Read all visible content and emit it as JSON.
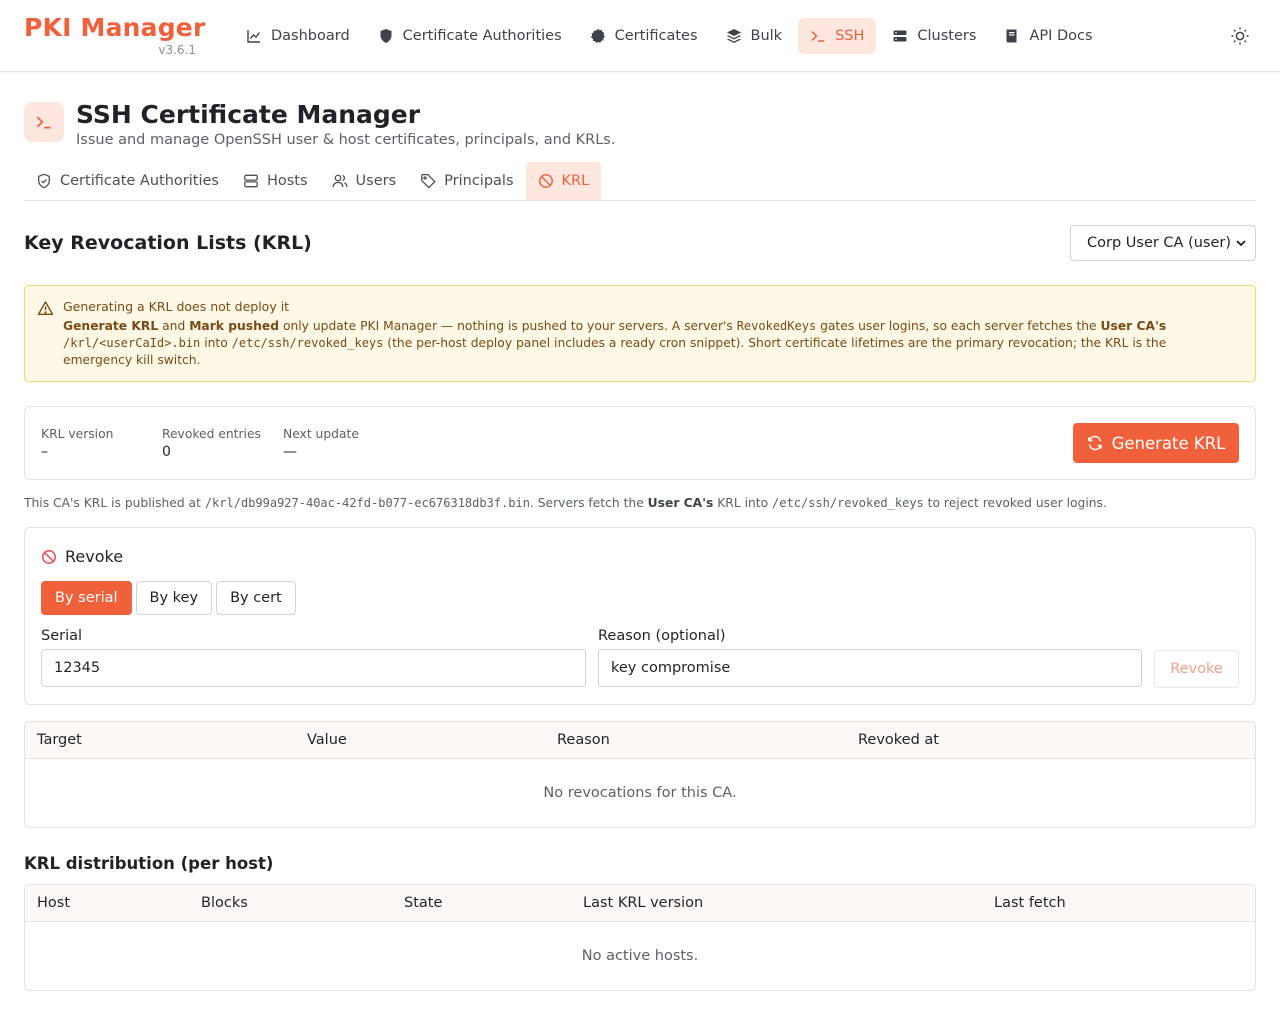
{
  "app": {
    "name": "PKI Manager",
    "version": "v3.6.1"
  },
  "nav": {
    "items": [
      {
        "label": "Dashboard",
        "icon": "chart-line-icon"
      },
      {
        "label": "Certificate Authorities",
        "icon": "shield-icon"
      },
      {
        "label": "Certificates",
        "icon": "badge-icon"
      },
      {
        "label": "Bulk",
        "icon": "layers-icon"
      },
      {
        "label": "SSH",
        "icon": "terminal-icon",
        "active": true
      },
      {
        "label": "Clusters",
        "icon": "server-icon"
      },
      {
        "label": "API Docs",
        "icon": "book-icon"
      }
    ],
    "theme_toggle_icon": "sun-icon"
  },
  "page": {
    "title": "SSH Certificate Manager",
    "subtitle": "Issue and manage OpenSSH user & host certificates, principals, and KRLs.",
    "icon": "terminal-icon"
  },
  "subtabs": [
    {
      "label": "Certificate Authorities",
      "icon": "shield-check-icon"
    },
    {
      "label": "Hosts",
      "icon": "server-icon"
    },
    {
      "label": "Users",
      "icon": "users-icon"
    },
    {
      "label": "Principals",
      "icon": "tag-icon"
    },
    {
      "label": "KRL",
      "icon": "ban-icon",
      "active": true
    }
  ],
  "krl": {
    "title": "Key Revocation Lists (KRL)",
    "ca_select": "Corp User CA (user)"
  },
  "warning": {
    "title": "Generating a KRL does not deploy it",
    "p1_b1": "Generate KRL",
    "p1_t1": " and ",
    "p1_b2": "Mark pushed",
    "p1_t2": " only update PKI Manager — nothing is pushed to your servers. A server's ",
    "p1_c1": "RevokedKeys",
    "p1_t3": " gates user logins, so each server fetches the ",
    "p1_b3": "User CA's",
    "p1_c2": "/krl/<userCaId>.bin",
    "p1_t4": " into ",
    "p1_c3": "/etc/ssh/revoked_keys",
    "p1_t5": " (the per-host deploy panel includes a ready cron snippet). Short certificate lifetimes are the primary revocation; the KRL is the emergency kill switch."
  },
  "stats": {
    "version_label": "KRL version",
    "version_value": "–",
    "revoked_label": "Revoked entries",
    "revoked_value": "0",
    "next_label": "Next update",
    "next_value": "—",
    "generate_button": "Generate KRL"
  },
  "note": {
    "t1": "This CA's KRL is published at ",
    "c1": "/krl/db99a927-40ac-42fd-b077-ec676318db3f.bin",
    "t2": ". Servers fetch the ",
    "b1": "User CA's",
    "t3": " KRL into ",
    "c2": "/etc/ssh/revoked_keys",
    "t4": " to reject revoked user logins."
  },
  "revoke": {
    "title": "Revoke",
    "modes": [
      "By serial",
      "By key",
      "By cert"
    ],
    "serial_label": "Serial",
    "serial_value": "12345",
    "reason_label": "Reason (optional)",
    "reason_value": "key compromise",
    "submit": "Revoke"
  },
  "revocations_table": {
    "columns": [
      "Target",
      "Value",
      "Reason",
      "Revoked at"
    ],
    "empty": "No revocations for this CA."
  },
  "distribution": {
    "title": "KRL distribution (per host)",
    "columns": [
      "Host",
      "Blocks",
      "State",
      "Last KRL version",
      "Last fetch"
    ],
    "empty": "No active hosts."
  },
  "colors": {
    "accent": "#f0603b",
    "accent_soft": "#fde7df",
    "warning_bg": "#fef9e6",
    "warning_border": "#f2d774"
  }
}
